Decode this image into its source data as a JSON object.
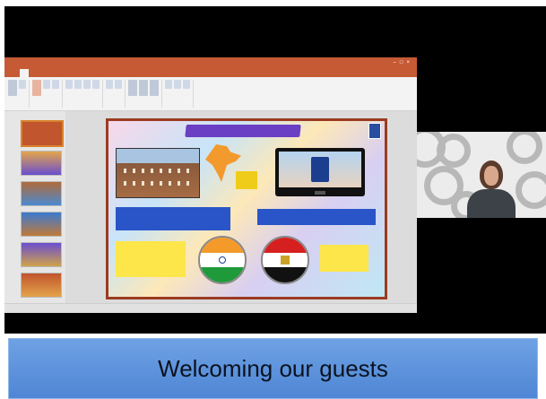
{
  "caption": {
    "text": "Welcoming our guests"
  },
  "colors": {
    "ppt_accent": "#c55a35",
    "caption_bg": "#5b8fdc",
    "slide_border": "#9b3b22",
    "banner_purple": "#6b3fc4",
    "highlight_yellow": "#fde64a"
  },
  "icons": [
    "window-minimize-icon",
    "window-maximize-icon",
    "window-close-icon",
    "india-flag-icon",
    "egypt-flag-icon",
    "india-map-icon",
    "school-emblem-icon"
  ]
}
